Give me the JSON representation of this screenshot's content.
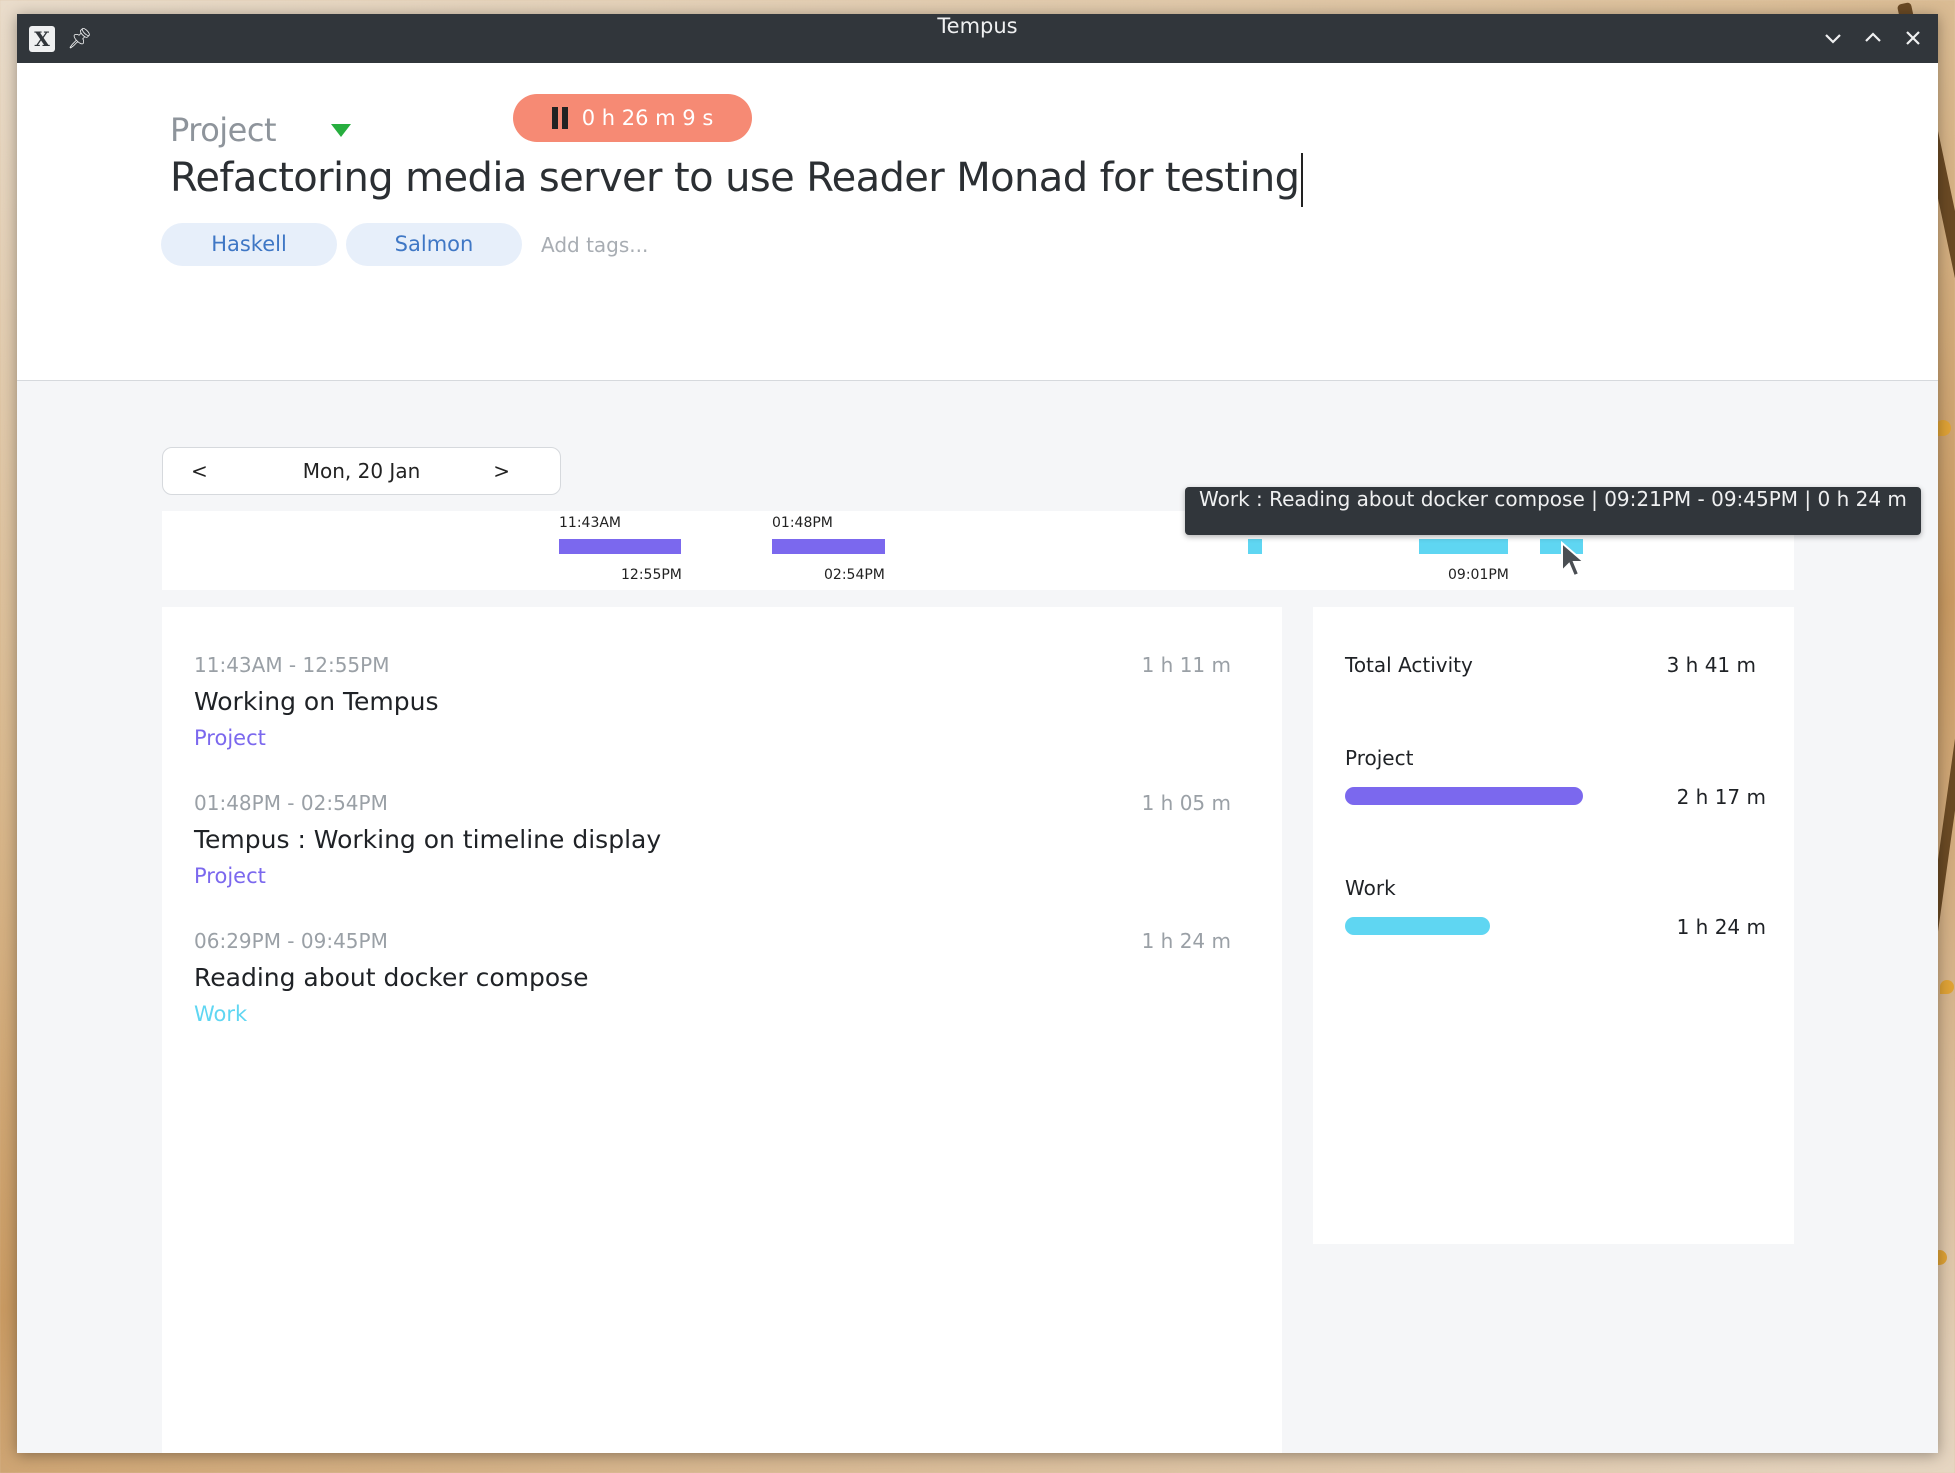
{
  "window": {
    "title": "Tempus"
  },
  "header": {
    "project_label": "Project",
    "timer_label": "0 h 26 m 9 s",
    "task_title": "Refactoring media server to use Reader Monad for testing",
    "tags": [
      "Haskell",
      "Salmon"
    ],
    "add_tags_placeholder": "Add tags..."
  },
  "date_nav": {
    "prev": "<",
    "date": "Mon, 20 Jan",
    "next": ">"
  },
  "colors": {
    "project": "#7b68ee",
    "work": "#5fd6f2",
    "timer": "#f68a74",
    "tag_bg": "#e7effa",
    "tag_text": "#3f77c5"
  },
  "timeline": {
    "labels_top": [
      "11:43AM",
      "01:48PM"
    ],
    "labels_bottom": [
      "12:55PM",
      "02:54PM",
      "09:01PM"
    ]
  },
  "tooltip": "Work : Reading about docker compose | 09:21PM - 09:45PM | 0 h 24 m",
  "entries": [
    {
      "time": "11:43AM - 12:55PM",
      "duration": "1 h 11 m",
      "name": "Working on Tempus",
      "category": "Project"
    },
    {
      "time": "01:48PM - 02:54PM",
      "duration": "1 h 05 m",
      "name": "Tempus : Working on timeline display",
      "category": "Project"
    },
    {
      "time": "06:29PM - 09:45PM",
      "duration": "1 h 24 m",
      "name": "Reading about docker compose",
      "category": "Work"
    }
  ],
  "stats": {
    "total_label": "Total Activity",
    "total_value": "3 h 41 m",
    "categories": [
      {
        "name": "Project",
        "value": "2 h 17 m",
        "share": 1.0
      },
      {
        "name": "Work",
        "value": "1 h 24 m",
        "share": 0.61
      }
    ]
  }
}
